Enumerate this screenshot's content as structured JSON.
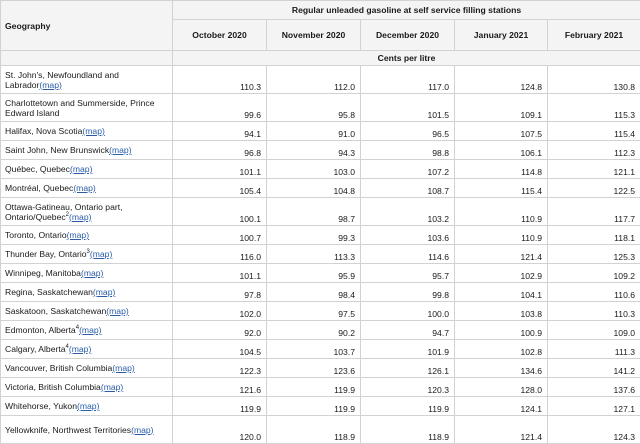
{
  "header": {
    "geography": "Geography",
    "group_title": "Regular unleaded gasoline at self service filling stations",
    "months": [
      "October 2020",
      "November 2020",
      "December 2020",
      "January 2021",
      "February 2021"
    ],
    "units": "Cents per litre"
  },
  "map_label": "(map)",
  "rows": [
    {
      "geo": "St. John's, Newfoundland and Labrador",
      "sup": "",
      "map": true,
      "tall": true,
      "values": [
        "110.3",
        "112.0",
        "117.0",
        "124.8",
        "130.8"
      ]
    },
    {
      "geo": "Charlottetown and Summerside, Prince Edward Island",
      "sup": "",
      "map": false,
      "tall": true,
      "values": [
        "99.6",
        "95.8",
        "101.5",
        "109.1",
        "115.3"
      ]
    },
    {
      "geo": "Halifax, Nova Scotia",
      "sup": "",
      "map": true,
      "tall": false,
      "values": [
        "94.1",
        "91.0",
        "96.5",
        "107.5",
        "115.4"
      ]
    },
    {
      "geo": "Saint John, New Brunswick",
      "sup": "",
      "map": true,
      "tall": false,
      "values": [
        "96.8",
        "94.3",
        "98.8",
        "106.1",
        "112.3"
      ]
    },
    {
      "geo": "Québec, Quebec",
      "sup": "",
      "map": true,
      "tall": false,
      "values": [
        "101.1",
        "103.0",
        "107.2",
        "114.8",
        "121.1"
      ]
    },
    {
      "geo": "Montréal, Quebec",
      "sup": "",
      "map": true,
      "tall": false,
      "values": [
        "105.4",
        "104.8",
        "108.7",
        "115.4",
        "122.5"
      ]
    },
    {
      "geo": "Ottawa-Gatineau, Ontario part, Ontario/Quebec",
      "sup": "2",
      "map": true,
      "tall": true,
      "values": [
        "100.1",
        "98.7",
        "103.2",
        "110.9",
        "117.7"
      ]
    },
    {
      "geo": "Toronto, Ontario",
      "sup": "",
      "map": true,
      "tall": false,
      "values": [
        "100.7",
        "99.3",
        "103.6",
        "110.9",
        "118.1"
      ]
    },
    {
      "geo": "Thunder Bay, Ontario",
      "sup": "3",
      "map": true,
      "tall": false,
      "values": [
        "116.0",
        "113.3",
        "114.6",
        "121.4",
        "125.3"
      ]
    },
    {
      "geo": "Winnipeg, Manitoba",
      "sup": "",
      "map": true,
      "tall": false,
      "values": [
        "101.1",
        "95.9",
        "95.7",
        "102.9",
        "109.2"
      ]
    },
    {
      "geo": "Regina, Saskatchewan",
      "sup": "",
      "map": true,
      "tall": false,
      "values": [
        "97.8",
        "98.4",
        "99.8",
        "104.1",
        "110.6"
      ]
    },
    {
      "geo": "Saskatoon, Saskatchewan",
      "sup": "",
      "map": true,
      "tall": false,
      "values": [
        "102.0",
        "97.5",
        "100.0",
        "103.8",
        "110.3"
      ]
    },
    {
      "geo": "Edmonton, Alberta",
      "sup": "4",
      "map": true,
      "tall": false,
      "values": [
        "92.0",
        "90.2",
        "94.7",
        "100.9",
        "109.0"
      ]
    },
    {
      "geo": "Calgary, Alberta",
      "sup": "4",
      "map": true,
      "tall": false,
      "values": [
        "104.5",
        "103.7",
        "101.9",
        "102.8",
        "111.3"
      ]
    },
    {
      "geo": "Vancouver, British Columbia",
      "sup": "",
      "map": true,
      "tall": false,
      "values": [
        "122.3",
        "123.6",
        "126.1",
        "134.6",
        "141.2"
      ]
    },
    {
      "geo": "Victoria, British Columbia",
      "sup": "",
      "map": true,
      "tall": false,
      "values": [
        "121.6",
        "119.9",
        "120.3",
        "128.0",
        "137.6"
      ]
    },
    {
      "geo": "Whitehorse, Yukon",
      "sup": "",
      "map": true,
      "tall": false,
      "values": [
        "119.9",
        "119.9",
        "119.9",
        "124.1",
        "127.1"
      ]
    },
    {
      "geo": "Yellowknife, Northwest Territories",
      "sup": "",
      "map": true,
      "tall": true,
      "values": [
        "120.0",
        "118.9",
        "118.9",
        "121.4",
        "124.3"
      ]
    }
  ]
}
